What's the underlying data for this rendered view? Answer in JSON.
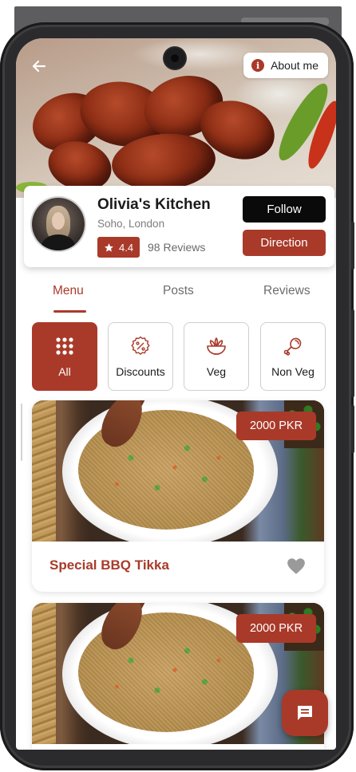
{
  "header": {
    "about_label": "About me"
  },
  "restaurant": {
    "name": "Olivia's Kitchen",
    "location": "Soho, London",
    "rating": "4.4",
    "reviews": "98 Reviews",
    "follow_label": "Follow",
    "direction_label": "Direction"
  },
  "tabs": [
    {
      "label": "Menu",
      "active": true
    },
    {
      "label": "Posts",
      "active": false
    },
    {
      "label": "Reviews",
      "active": false
    }
  ],
  "categories": [
    {
      "label": "All",
      "icon": "grid-icon",
      "active": true
    },
    {
      "label": "Discounts",
      "icon": "percent-badge-icon",
      "active": false
    },
    {
      "label": "Veg",
      "icon": "salad-bowl-icon",
      "active": false
    },
    {
      "label": "Non Veg",
      "icon": "chicken-leg-icon",
      "active": false
    }
  ],
  "menu_items": [
    {
      "name": "Special BBQ Tikka",
      "price": "2000 PKR"
    },
    {
      "price": "2000 PKR"
    }
  ],
  "colors": {
    "accent": "#a93a2a",
    "follow": "#0a0a0a",
    "heart": "#9a9a9a"
  }
}
